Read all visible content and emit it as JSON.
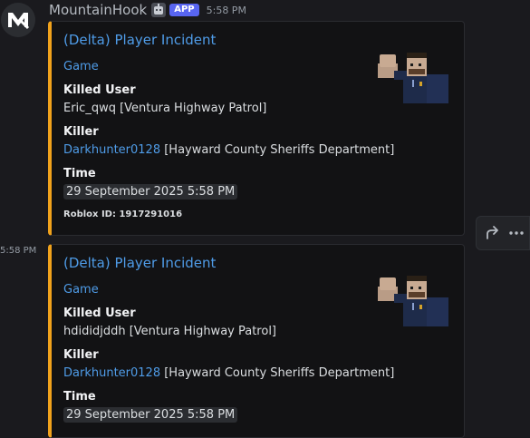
{
  "header": {
    "username": "MountainHook",
    "badge": "APP",
    "timestamp": "5:58 PM"
  },
  "side_timestamp": "5:58 PM",
  "embeds": [
    {
      "title": "(Delta) Player Incident",
      "description": "Game",
      "fields": [
        {
          "name": "Killed User",
          "value": "Eric_qwq [Ventura Highway Patrol]"
        },
        {
          "name": "Killer",
          "value_link": "Darkhunter0128",
          "value_rest": " [Hayward County Sheriffs Department]"
        },
        {
          "name": "Time",
          "value": "29 September 2025 5:58 PM"
        }
      ],
      "footer": "Roblox ID: 1917291016"
    },
    {
      "title": "(Delta) Player Incident",
      "description": "Game",
      "fields": [
        {
          "name": "Killed User",
          "value": "hdididjddh [Ventura Highway Patrol]"
        },
        {
          "name": "Killer",
          "value_link": "Darkhunter0128",
          "value_rest": " [Hayward County Sheriffs Department]"
        },
        {
          "name": "Time",
          "value": "29 September 2025 5:58 PM"
        }
      ]
    }
  ],
  "toolbar": {
    "forward_icon": "forward-icon",
    "more_icon": "more-icon"
  },
  "colors": {
    "accent": "#f0a21c",
    "link": "#4f9ce8",
    "badge": "#5865f2"
  }
}
